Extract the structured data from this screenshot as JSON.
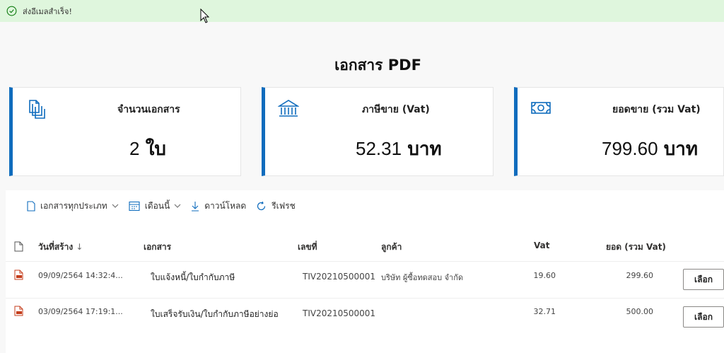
{
  "banner": {
    "message": "ส่งอีเมลสำเร็จ!",
    "icon": "check-circle-icon",
    "color": "#dff6dd"
  },
  "page_title": "เอกสาร PDF",
  "accent_color": "#0f6cbd",
  "cards": [
    {
      "label": "จำนวนเอกสาร",
      "number": "2",
      "unit": "ใบ",
      "icon": "documents-icon"
    },
    {
      "label": "ภาษีขาย (Vat)",
      "number": "52.31",
      "unit": "บาท",
      "icon": "bank-icon"
    },
    {
      "label": "ยอดขาย (รวม Vat)",
      "number": "799.60",
      "unit": "บาท",
      "icon": "money-icon"
    }
  ],
  "toolbar": {
    "doc_type": "เอกสารทุกประเภท",
    "period": "เดือนนี้",
    "download": "ดาวน์โหลด",
    "refresh": "รีเฟรช"
  },
  "table": {
    "headers": {
      "created": "วันที่สร้าง",
      "sort_arrow": "↓",
      "document": "เอกสาร",
      "number": "เลขที่",
      "customer": "ลูกค้า",
      "vat": "Vat",
      "total": "ยอด (รวม Vat)"
    },
    "rows": [
      {
        "created": "09/09/2564 14:32:4...",
        "document": "ใบแจ้งหนี้/ใบกำกับภาษี",
        "number": "TIV20210500001",
        "customer": "บริษัท ผู้ซื้อทดสอบ จำกัด",
        "vat": "19.60",
        "total": "299.60",
        "action": "เลือก"
      },
      {
        "created": "03/09/2564 17:19:1...",
        "document": "ใบเสร็จรับเงิน/ใบกำกับภาษีอย่างย่อ",
        "number": "TIV20210500001",
        "customer": "",
        "vat": "32.71",
        "total": "500.00",
        "action": "เลือก"
      }
    ]
  }
}
